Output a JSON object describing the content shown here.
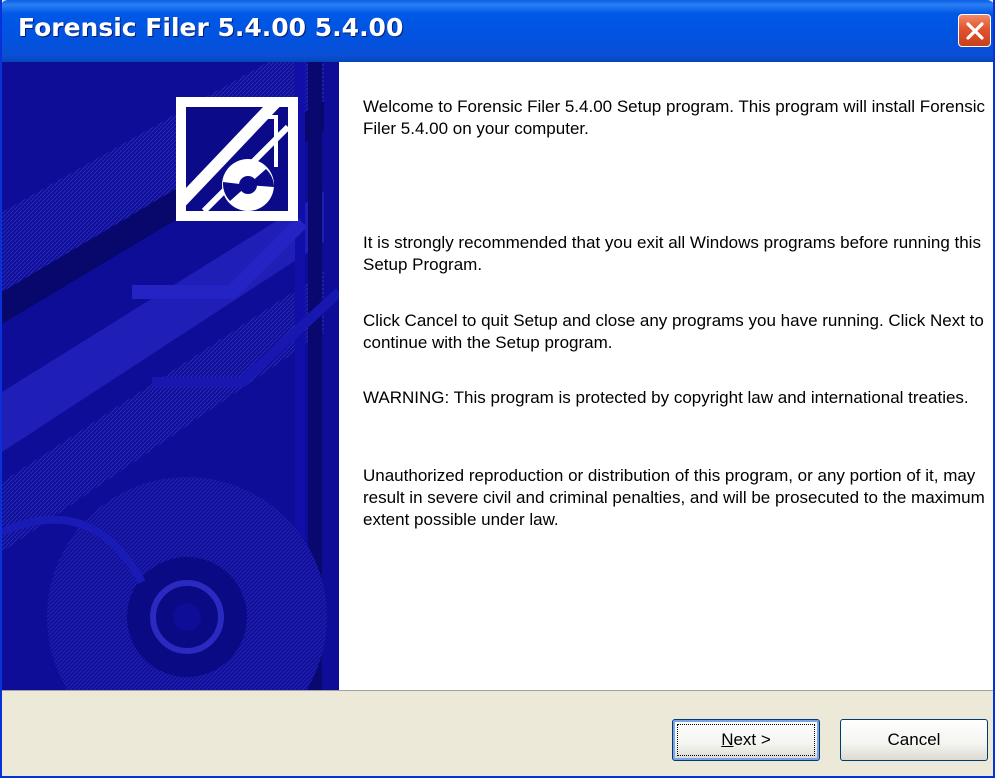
{
  "window": {
    "title": "Forensic Filer 5.4.00 5.4.00",
    "close_icon": "close-icon"
  },
  "content": {
    "paragraphs": [
      "Welcome to Forensic Filer 5.4.00 Setup program. This program will install Forensic Filer 5.4.00 on your computer.",
      "It is strongly recommended that you exit all Windows programs before running this Setup Program.",
      "Click Cancel to quit Setup and close any programs you have running.  Click Next to continue with the Setup program.",
      "WARNING: This program is protected by copyright law and international treaties.",
      "Unauthorized reproduction or distribution of this program, or any portion of it, may result in severe civil and criminal penalties, and will be prosecuted to the maximum extent possible under law."
    ]
  },
  "buttons": {
    "next_mnemonic": "N",
    "next_rest": "ext >",
    "cancel": "Cancel"
  },
  "colors": {
    "titlebar": "#0153e0",
    "banner": "#0d0d98",
    "close": "#e0542e"
  }
}
